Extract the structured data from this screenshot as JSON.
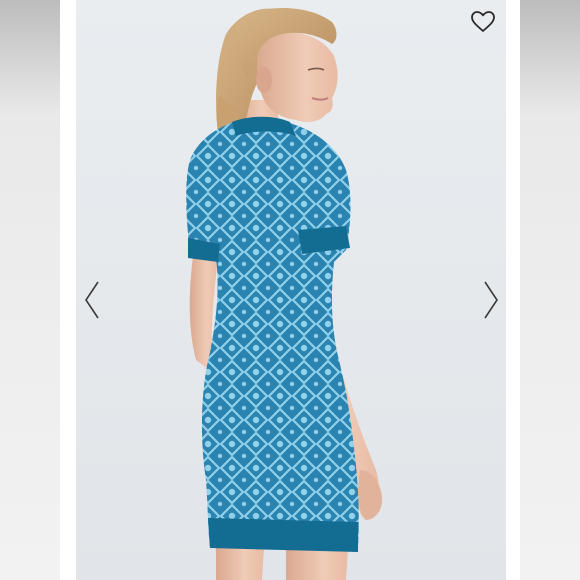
{
  "gallery": {
    "favorite_icon": "heart-outline-icon",
    "prev_icon": "chevron-left-icon",
    "next_icon": "chevron-right-icon",
    "colors": {
      "dress_base": "#2b84b0",
      "dress_pattern": "#8fd0ec",
      "dress_trim": "#136c91",
      "background": "#e6eaee"
    }
  }
}
